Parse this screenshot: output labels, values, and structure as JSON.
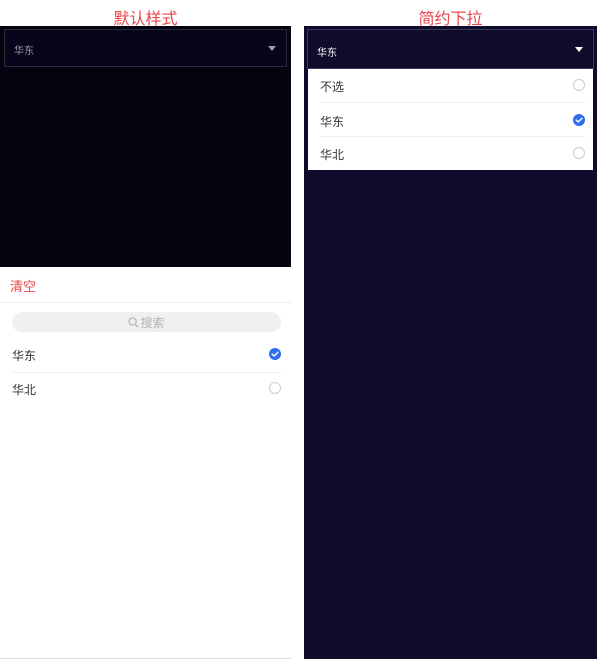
{
  "titles": {
    "left": "默认样式",
    "right": "简约下拉"
  },
  "left": {
    "select_value": "华东",
    "clear_label": "清空",
    "search_placeholder": "搜索",
    "options": [
      {
        "label": "华东",
        "selected": true
      },
      {
        "label": "华北",
        "selected": false
      }
    ]
  },
  "right": {
    "select_value": "华东",
    "options": [
      {
        "label": "不选",
        "selected": false
      },
      {
        "label": "华东",
        "selected": true
      },
      {
        "label": "华北",
        "selected": false
      }
    ]
  },
  "colors": {
    "accent_red": "#e8474b",
    "check_blue": "#2f6fed",
    "left_bg": "#04030f",
    "right_bg": "#0e0b2b"
  },
  "icons": [
    "caret-down-icon",
    "search-icon",
    "radio-checked-icon",
    "radio-unchecked-icon"
  ]
}
